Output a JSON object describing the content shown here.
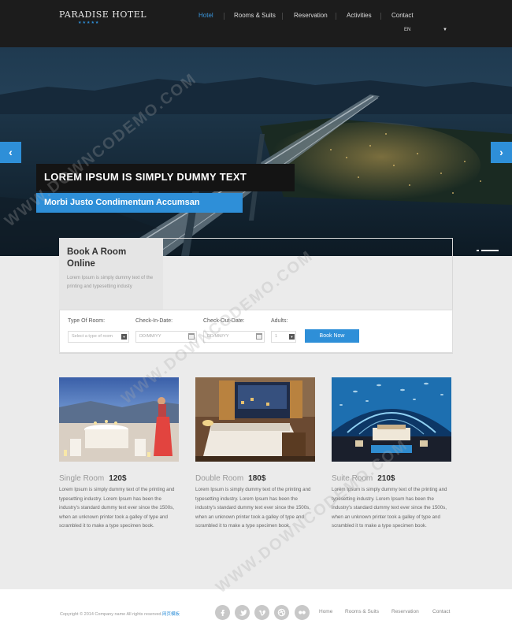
{
  "header": {
    "logo": "PARADISE HOTEL",
    "logo_stars": "★★★★★",
    "nav": [
      "Hotel",
      "Rooms & Suits",
      "Reservation",
      "Activities",
      "Contact"
    ],
    "active_nav": "Hotel",
    "language": "EN"
  },
  "hero": {
    "title": "LOREM IPSUM IS SIMPLY DUMMY TEXT",
    "subtitle": "Morbi Justo Condimentum Accumsan",
    "prev_glyph": "‹",
    "next_glyph": "›"
  },
  "booking": {
    "title": "Book A Room Online",
    "description": "Lorem Ipsum is simply dummy text of the printing and typesetting industy",
    "labels": {
      "room_type": "Type Of Room:",
      "check_in": "Check-In-Date:",
      "check_out": "Check-Out-Date:",
      "adults": "Adults:"
    },
    "room_type_placeholder": "Select a type of room",
    "check_in_placeholder": "DD/MM/YY",
    "check_out_placeholder": "DD/MM/YY",
    "adults_value": "1",
    "book_button": "Book Now"
  },
  "rooms": [
    {
      "name": "Single Room",
      "price": "120$",
      "description": "Lorem Ipsum is simply dummy text of the printing and typesetting industry. Lorem Ipsum has been the industry's standard dummy text ever since the 1500s, when an unknown printer took a galley of type and scrambled it to make a type specimen book."
    },
    {
      "name": "Double Room",
      "price": "180$",
      "description": "Lorem Ipsum is simply dummy text of the printing and typesetting industry. Lorem Ipsum has been the industry's standard dummy text ever since the 1500s, when an unknown printer took a galley of type and scrambled it to make a type specimen book."
    },
    {
      "name": "Suite Room",
      "price": "210$",
      "description": "Lorem Ipsum is simply dummy text of the printing and typesetting industry. Lorem Ipsum has been the industry's standard dummy text ever since the 1500s, when an unknown printer took a galley of type and scrambled it to make a type specimen book."
    }
  ],
  "footer": {
    "copyright": "Copyright © 2014 Company name All rights reserved.",
    "copyright_link": "网页模板",
    "social_icons": [
      "facebook-icon",
      "twitter-icon",
      "vimeo-icon",
      "dribbble-icon",
      "flickr-icon"
    ],
    "links": [
      "Home",
      "Rooms & Suits",
      "Reservation",
      "Contact"
    ]
  },
  "watermark": "WWW.DOWNCODEMO.COM",
  "colors": {
    "accent": "#2e8fd8",
    "header_bg": "#1c1c1c",
    "page_bg": "#ebebeb"
  }
}
